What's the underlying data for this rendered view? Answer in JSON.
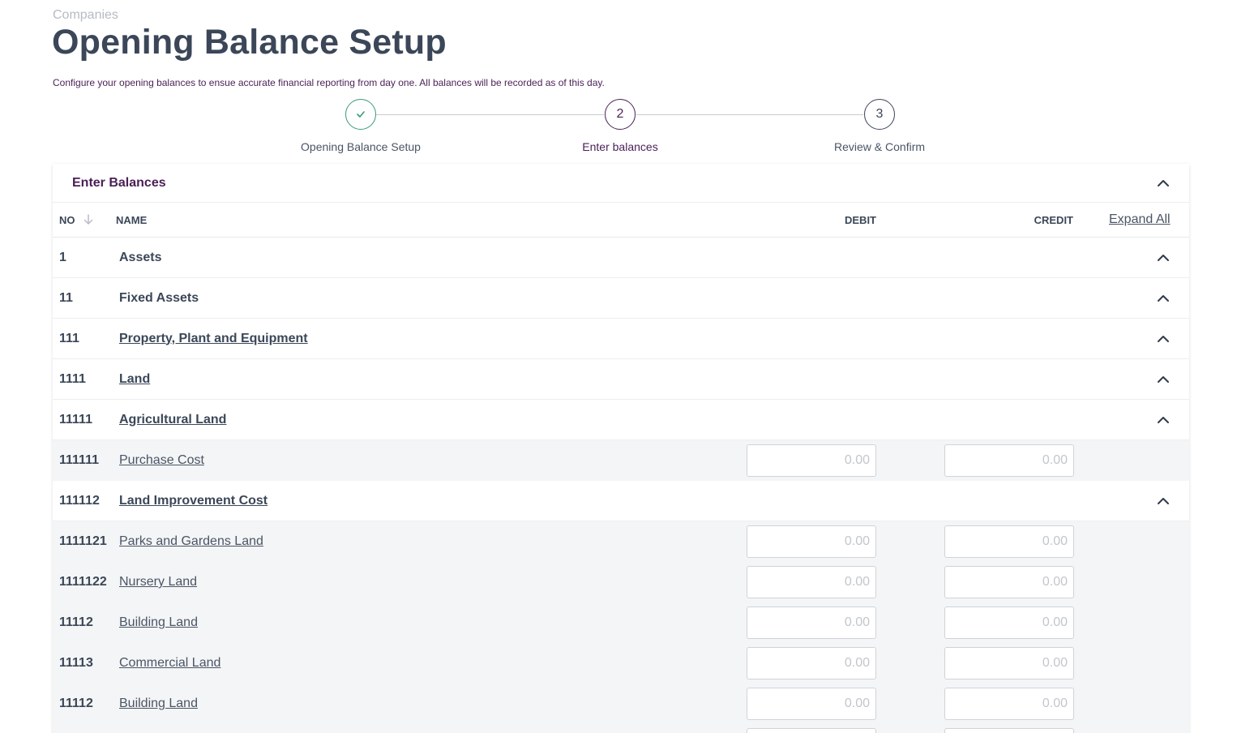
{
  "breadcrumb": "Companies",
  "title": "Opening Balance Setup",
  "description": "Configure your opening balances to ensue accurate financial reporting from day one. All balances will be recorded as of this day.",
  "stepper": {
    "steps": [
      {
        "number": "",
        "label": "Opening Balance Setup",
        "state": "done"
      },
      {
        "number": "2",
        "label": "Enter balances",
        "state": "active"
      },
      {
        "number": "3",
        "label": "Review & Confirm",
        "state": "pending"
      }
    ]
  },
  "card": {
    "title": "Enter Balances"
  },
  "table": {
    "headers": {
      "no": "NO",
      "name": "NAME",
      "debit": "DEBIT",
      "credit": "CREDIT",
      "expand_all": "Expand All"
    },
    "rows": [
      {
        "no": "1",
        "name": "Assets",
        "type": "group",
        "link": false
      },
      {
        "no": "11",
        "name": "Fixed Assets",
        "type": "group",
        "link": false
      },
      {
        "no": "111",
        "name": "Property, Plant and Equipment",
        "type": "group",
        "link": true
      },
      {
        "no": "1111",
        "name": "Land",
        "type": "group",
        "link": true
      },
      {
        "no": "11111",
        "name": "Agricultural Land",
        "type": "group",
        "link": true
      },
      {
        "no": "111111",
        "name": "Purchase Cost",
        "type": "leaf",
        "link": true
      },
      {
        "no": "111112",
        "name": "Land Improvement Cost",
        "type": "group",
        "link": true
      },
      {
        "no": "1111121",
        "name": "Parks and Gardens Land",
        "type": "leaf",
        "link": true
      },
      {
        "no": "1111122",
        "name": "Nursery Land",
        "type": "leaf",
        "link": true
      },
      {
        "no": "11112",
        "name": "Building Land",
        "type": "leaf",
        "link": true
      },
      {
        "no": "11113",
        "name": "Commercial Land",
        "type": "leaf",
        "link": true
      },
      {
        "no": "11112",
        "name": "Building Land",
        "type": "leaf",
        "link": true
      },
      {
        "no": "",
        "name": "",
        "type": "leaf",
        "link": true
      }
    ],
    "amount_placeholder": "0.00"
  },
  "colors": {
    "brand": "#4a1f55",
    "success": "#3b9a7a",
    "text": "#3b4758"
  }
}
